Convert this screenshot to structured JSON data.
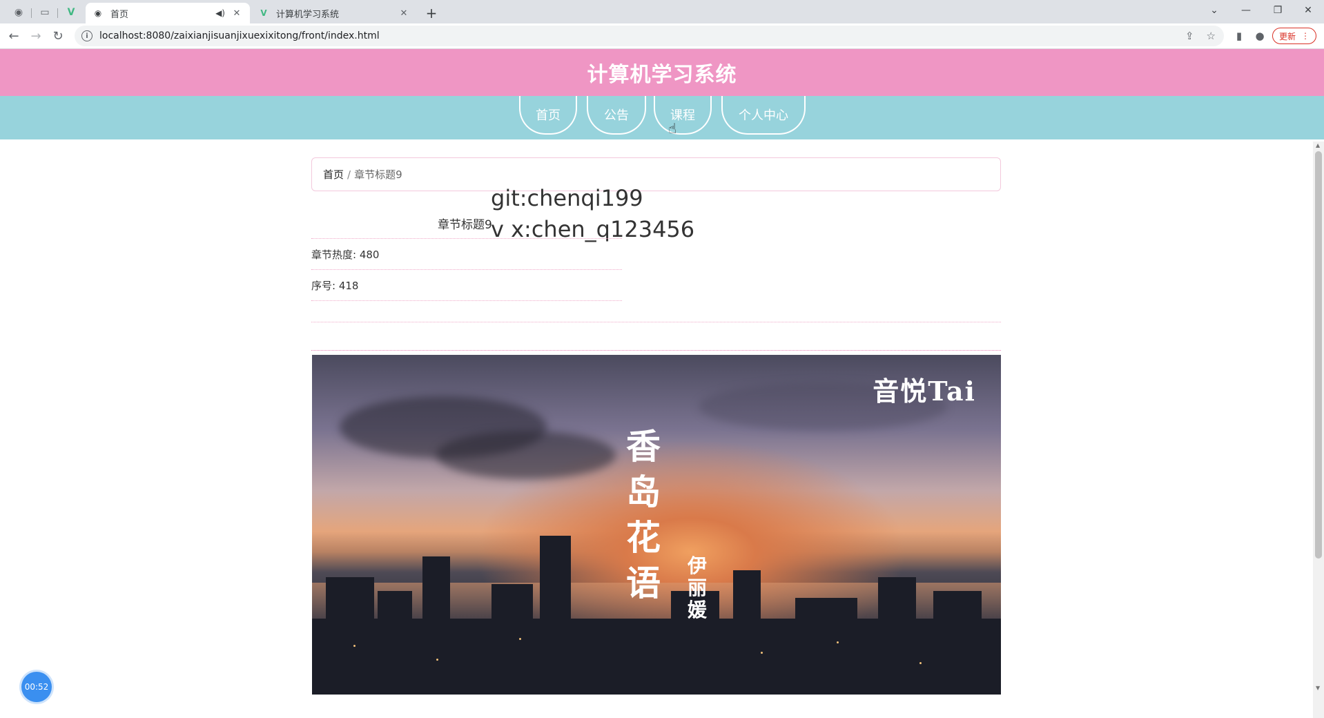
{
  "browser": {
    "tabs": [
      {
        "title": "首页",
        "favicon": "globe-icon",
        "active": true
      },
      {
        "title": "计算机学习系统",
        "favicon": "vue-icon",
        "active": false
      }
    ],
    "url": "localhost:8080/zaixianjisuanjixuexixitong/front/index.html",
    "update_label": "更新"
  },
  "site": {
    "title": "计算机学习系统",
    "nav": [
      "首页",
      "公告",
      "课程",
      "个人中心"
    ],
    "header_color": "#ef96c4",
    "nav_color": "#97d3dc"
  },
  "breadcrumb": {
    "home": "首页",
    "separator": "/",
    "current": "章节标题9"
  },
  "watermark": {
    "line1": "git:chenqi199",
    "line2": "v x:chen_q123456"
  },
  "detail": {
    "title": "章节标题9",
    "heat": "章节热度: 480",
    "serial": "序号: 418"
  },
  "video": {
    "brand": "音悦Tai",
    "title_chars": [
      "香",
      "岛",
      "花",
      "语"
    ],
    "singer_chars": [
      "伊",
      "丽",
      "媛"
    ]
  },
  "timer": "00:52"
}
